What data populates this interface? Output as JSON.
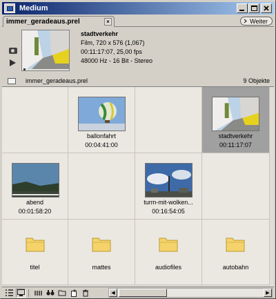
{
  "window": {
    "title": "Medium"
  },
  "tab": {
    "label": "immer_geradeaus.prel",
    "close": "×"
  },
  "weiter": "Weiter",
  "preview": {
    "clip_name": "stadtverkehr",
    "line1": "Film, 720 x 576 (1,067)",
    "line2": "00:11:17:07, 25,00 fps",
    "line3": "48000 Hz - 16 Bit - Stereo"
  },
  "folderbar": {
    "label": "immer_geradeaus.prel",
    "count": "9 Objekte"
  },
  "items": [
    {
      "name": "",
      "duration": ""
    },
    {
      "name": "ballonfahrt",
      "duration": "00:04:41:00"
    },
    {
      "name": "",
      "duration": ""
    },
    {
      "name": "stadtverkehr",
      "duration": "00:11:17:07",
      "selected": true
    },
    {
      "name": "abend",
      "duration": "00:01:58:20"
    },
    {
      "name": "",
      "duration": ""
    },
    {
      "name": "turm-mit-wolken...",
      "duration": "00:16:54:05"
    },
    {
      "name": "",
      "duration": ""
    },
    {
      "name": "titel",
      "type": "folder"
    },
    {
      "name": "mattes",
      "type": "folder"
    },
    {
      "name": "audiofiles",
      "type": "folder"
    },
    {
      "name": "autobahn",
      "type": "folder"
    }
  ],
  "colors": {
    "titlebar": "#0a246a",
    "selected": "#a0a0a0",
    "folder": "#f5d36a"
  }
}
